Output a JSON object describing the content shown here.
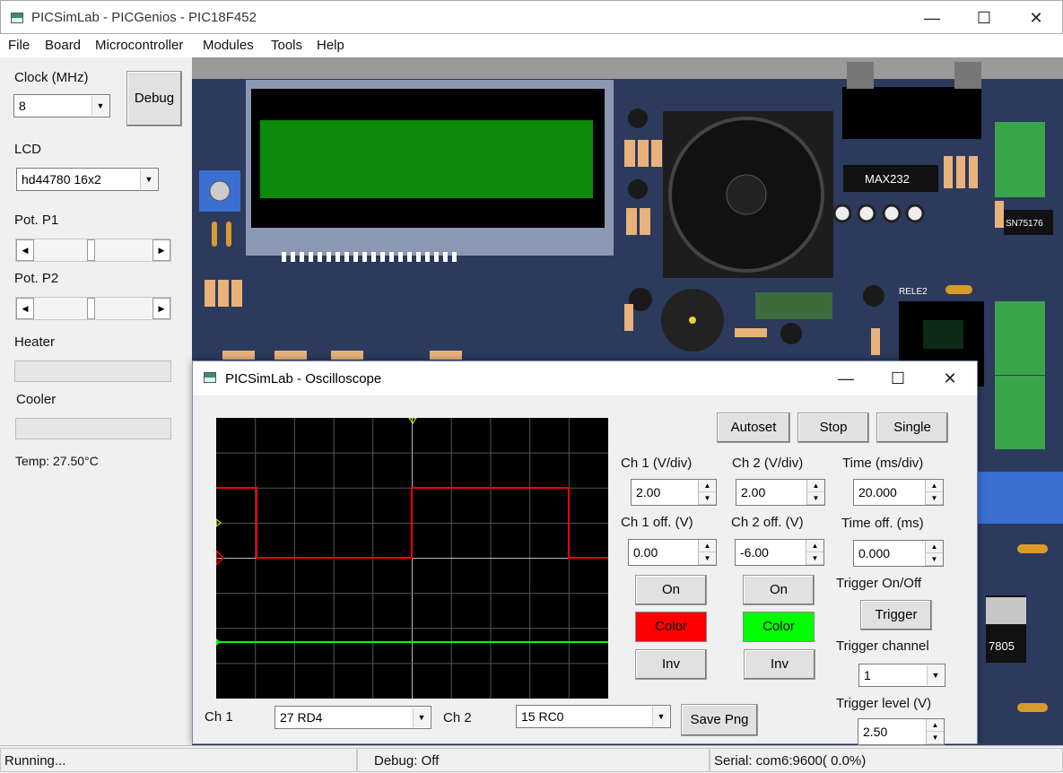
{
  "window": {
    "title": "PICSimLab - PICGenios - PIC18F452"
  },
  "menu": [
    "File",
    "Board",
    "Microcontroller",
    "Modules",
    "Tools",
    "Help"
  ],
  "left": {
    "clock_label": "Clock (MHz)",
    "clock_value": "8",
    "debug_button": "Debug",
    "lcd_label": "LCD",
    "lcd_value": "hd44780 16x2",
    "pot1_label": "Pot. P1",
    "pot1_level": 0.48,
    "pot2_label": "Pot. P2",
    "pot2_level": 0.48,
    "heater_label": "Heater",
    "heater_level": 0,
    "cooler_label": "Cooler",
    "cooler_level": 0,
    "temp": "Temp: 27.50°C"
  },
  "board": {
    "chip_max232": "MAX232",
    "chip_sn75176": "SN75176",
    "relay_label": "RELE2",
    "regulator_label": "7805"
  },
  "scope": {
    "title": "PICSimLab - Oscilloscope",
    "buttons": {
      "autoset": "Autoset",
      "stop": "Stop",
      "single": "Single",
      "save_png": "Save Png"
    },
    "ch1": {
      "vdiv_label": "Ch 1 (V/div)",
      "vdiv": "2.00",
      "off_label": "Ch 1 off. (V)",
      "off": "0.00",
      "on": "On",
      "color": "Color",
      "inv": "Inv",
      "color_hex": "#ff0000",
      "select_label": "Ch 1",
      "select_value": "27  RD4"
    },
    "ch2": {
      "vdiv_label": "Ch 2 (V/div)",
      "vdiv": "2.00",
      "off_label": "Ch 2 off. (V)",
      "off": "-6.00",
      "on": "On",
      "color": "Color",
      "inv": "Inv",
      "color_hex": "#00ff00",
      "select_label": "Ch 2",
      "select_value": "15  RC0"
    },
    "time": {
      "tdiv_label": "Time (ms/div)",
      "tdiv": "20.000",
      "toff_label": "Time off. (ms)",
      "toff": "0.000"
    },
    "trigger": {
      "onoff_label": "Trigger On/Off",
      "button": "Trigger",
      "channel_label": "Trigger channel",
      "channel": "1",
      "level_label": "Trigger level (V)",
      "level": "2.50"
    }
  },
  "status": {
    "run": "Running...",
    "debug": "Debug: Off",
    "serial": "Serial: com6:9600( 0.0%)"
  }
}
